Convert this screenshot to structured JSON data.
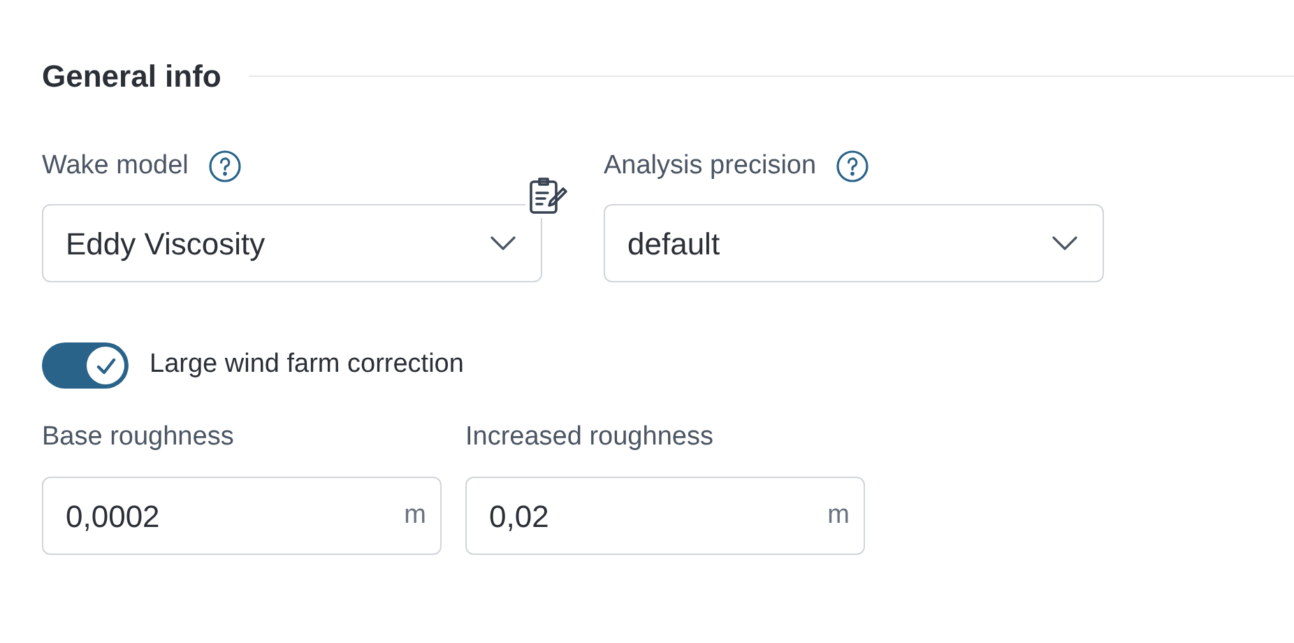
{
  "section": {
    "title": "General info"
  },
  "fields": [
    {
      "label": "Wake model",
      "help": true,
      "value": "Eddy Viscosity",
      "notes": true
    },
    {
      "label": "Analysis precision",
      "help": true,
      "value": "default",
      "notes": false
    }
  ],
  "toggle": {
    "label": "Large wind farm correction",
    "on": true
  },
  "inputs": [
    {
      "label": "Base roughness",
      "value": "0,0002",
      "unit": "m"
    },
    {
      "label": "Increased roughness",
      "value": "0,02",
      "unit": "m"
    }
  ]
}
